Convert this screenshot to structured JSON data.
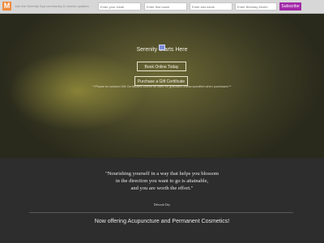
{
  "topbar": {
    "logo_letter": "M",
    "text": "Join the Serenity Spa community & receive updates",
    "email_placeholder": "Enter your email",
    "first_name_placeholder": "Enter first name",
    "last_name_placeholder": "Enter last name",
    "birthday_placeholder": "Enter Birthday Month",
    "subscribe_label": "Subscribe",
    "subscribe_color": "#a229a8",
    "logo_color": "#f08a3c"
  },
  "hero": {
    "title": "Serenity Starts Here",
    "book_button": "Book Online Today",
    "gift_button": "Purchase a Gift Certificate",
    "disclaimer": "**Please be advised Gift Certificates cannot be used for gratuities unless specified when purchased.**"
  },
  "quote_section": {
    "quote_line1": "\"Nourishing yourself in a way that helps you blossom",
    "quote_line2": "in the direction you want to go is attainable,",
    "quote_line3": "and you are worth the effort.\"",
    "author": "Deborah Day",
    "announcement": "Now offering Acupuncture and Permanent Cosmetics!"
  }
}
